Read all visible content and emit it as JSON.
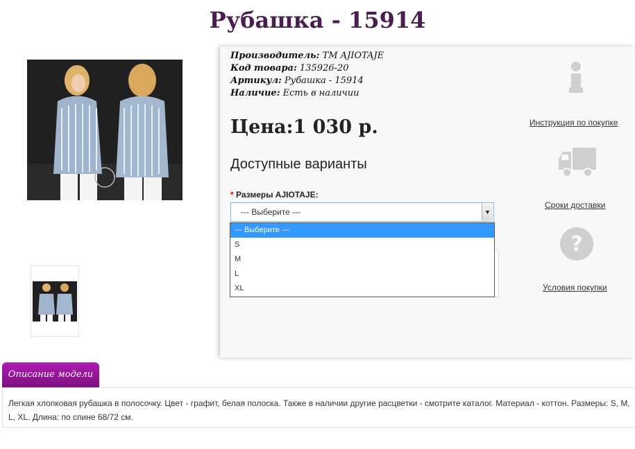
{
  "product": {
    "title": "Рубашка - 15914",
    "manufacturer_label": "Производитель:",
    "manufacturer_value": "TM AJIOTAJE",
    "code_label": "Код товара:",
    "code_value": "135926-20",
    "article_label": "Артикул:",
    "article_value": "Рубашка - 15914",
    "availability_label": "Наличие:",
    "availability_value": "Есть в наличии",
    "price": "Цена:1 030 р.",
    "variants_heading": "Доступные варианты"
  },
  "size_select": {
    "required_mark": "*",
    "label": "Размеры AJIOTAJE:",
    "selected": "--- Выберите ---",
    "options": [
      "--- Выберите ---",
      "S",
      "M",
      "L",
      "XL"
    ]
  },
  "sidebar": {
    "instructions_link": "Инструкция по покупке",
    "delivery_link": "Сроки доставки",
    "conditions_link": "Условия покупки"
  },
  "description": {
    "tab_label": "Описание модели",
    "text": "Легкая хлопковая рубашка в полосочку. Цвет - графит, белая полоска. Также в наличии другие расцветки - смотрите каталог. Материал - коттон. Размеры: S, M, L, XL. Длина: по спине 68/72 см."
  },
  "colors": {
    "title": "#4a1e4f",
    "tab": "#9c17a0",
    "select_highlight": "#3399ff"
  },
  "icons": [
    "info-icon",
    "truck-icon",
    "question-icon"
  ]
}
